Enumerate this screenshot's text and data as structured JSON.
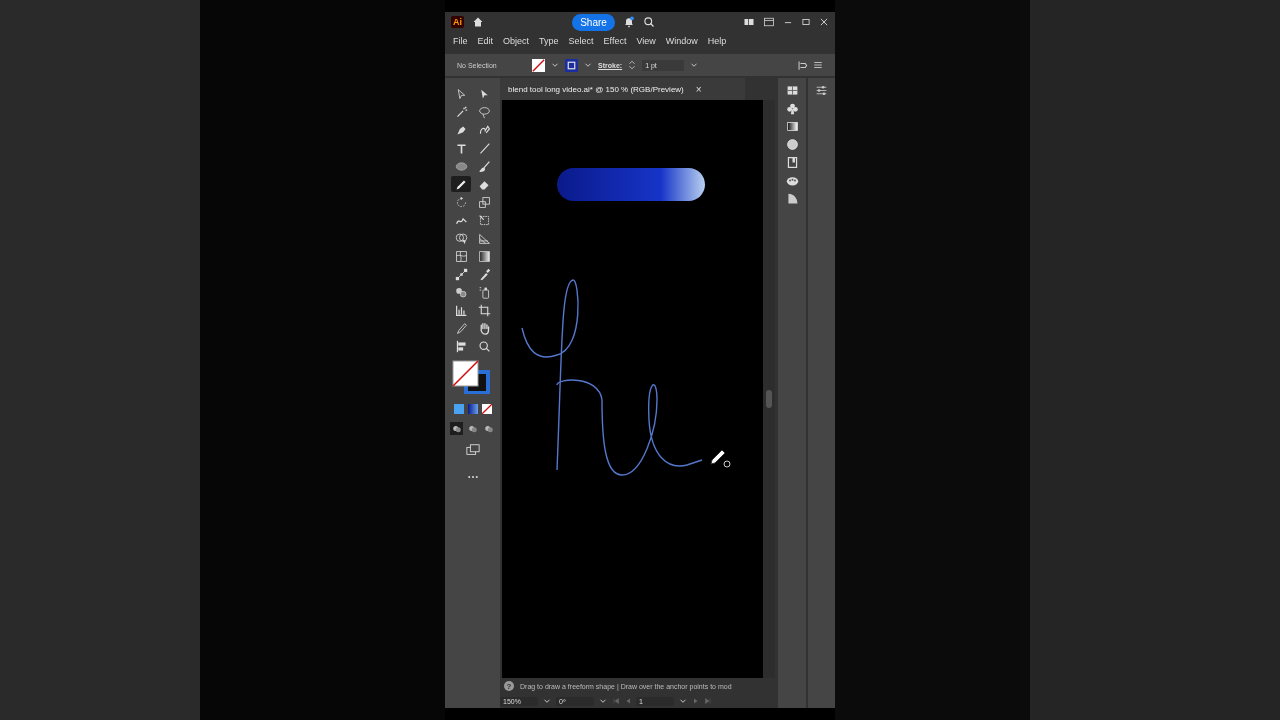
{
  "app": {
    "logo": "Ai",
    "share": "Share"
  },
  "menu": [
    "File",
    "Edit",
    "Object",
    "Type",
    "Select",
    "Effect",
    "View",
    "Window",
    "Help"
  ],
  "control_bar": {
    "selection": "No Selection",
    "stroke_label": "Stroke:",
    "stroke_weight": "1 pt"
  },
  "document_tab": {
    "title": "blend tool long video.ai* @ 150 % (RGB/Preview)",
    "close": "×"
  },
  "tools": [
    {
      "selected": false
    },
    {
      "selected": false
    },
    {
      "selected": false
    },
    {
      "selected": false
    },
    {
      "selected": false
    },
    {
      "selected": false
    },
    {
      "selected": false
    },
    {
      "selected": false
    },
    {
      "selected": false
    },
    {
      "selected": false
    },
    {
      "selected": true
    },
    {
      "selected": false
    },
    {
      "selected": false
    },
    {
      "selected": false
    },
    {
      "selected": false
    },
    {
      "selected": false
    },
    {
      "selected": false
    },
    {
      "selected": false
    },
    {
      "selected": false
    },
    {
      "selected": false
    },
    {
      "selected": false
    },
    {
      "selected": false
    },
    {
      "selected": false
    },
    {
      "selected": false
    },
    {
      "selected": false
    },
    {
      "selected": false
    },
    {
      "selected": false
    },
    {
      "selected": false
    },
    {
      "selected": false
    },
    {
      "selected": false
    }
  ],
  "draw_modes": [
    {
      "selected": true
    },
    {
      "selected": false
    },
    {
      "selected": false
    }
  ],
  "status_bar": {
    "help": "?",
    "hint": "Drag to draw a freeform shape  |  Draw over the anchor points to mod"
  },
  "bottom_bar": {
    "zoom": "150%",
    "rotation": "0º",
    "artboard": "1"
  }
}
